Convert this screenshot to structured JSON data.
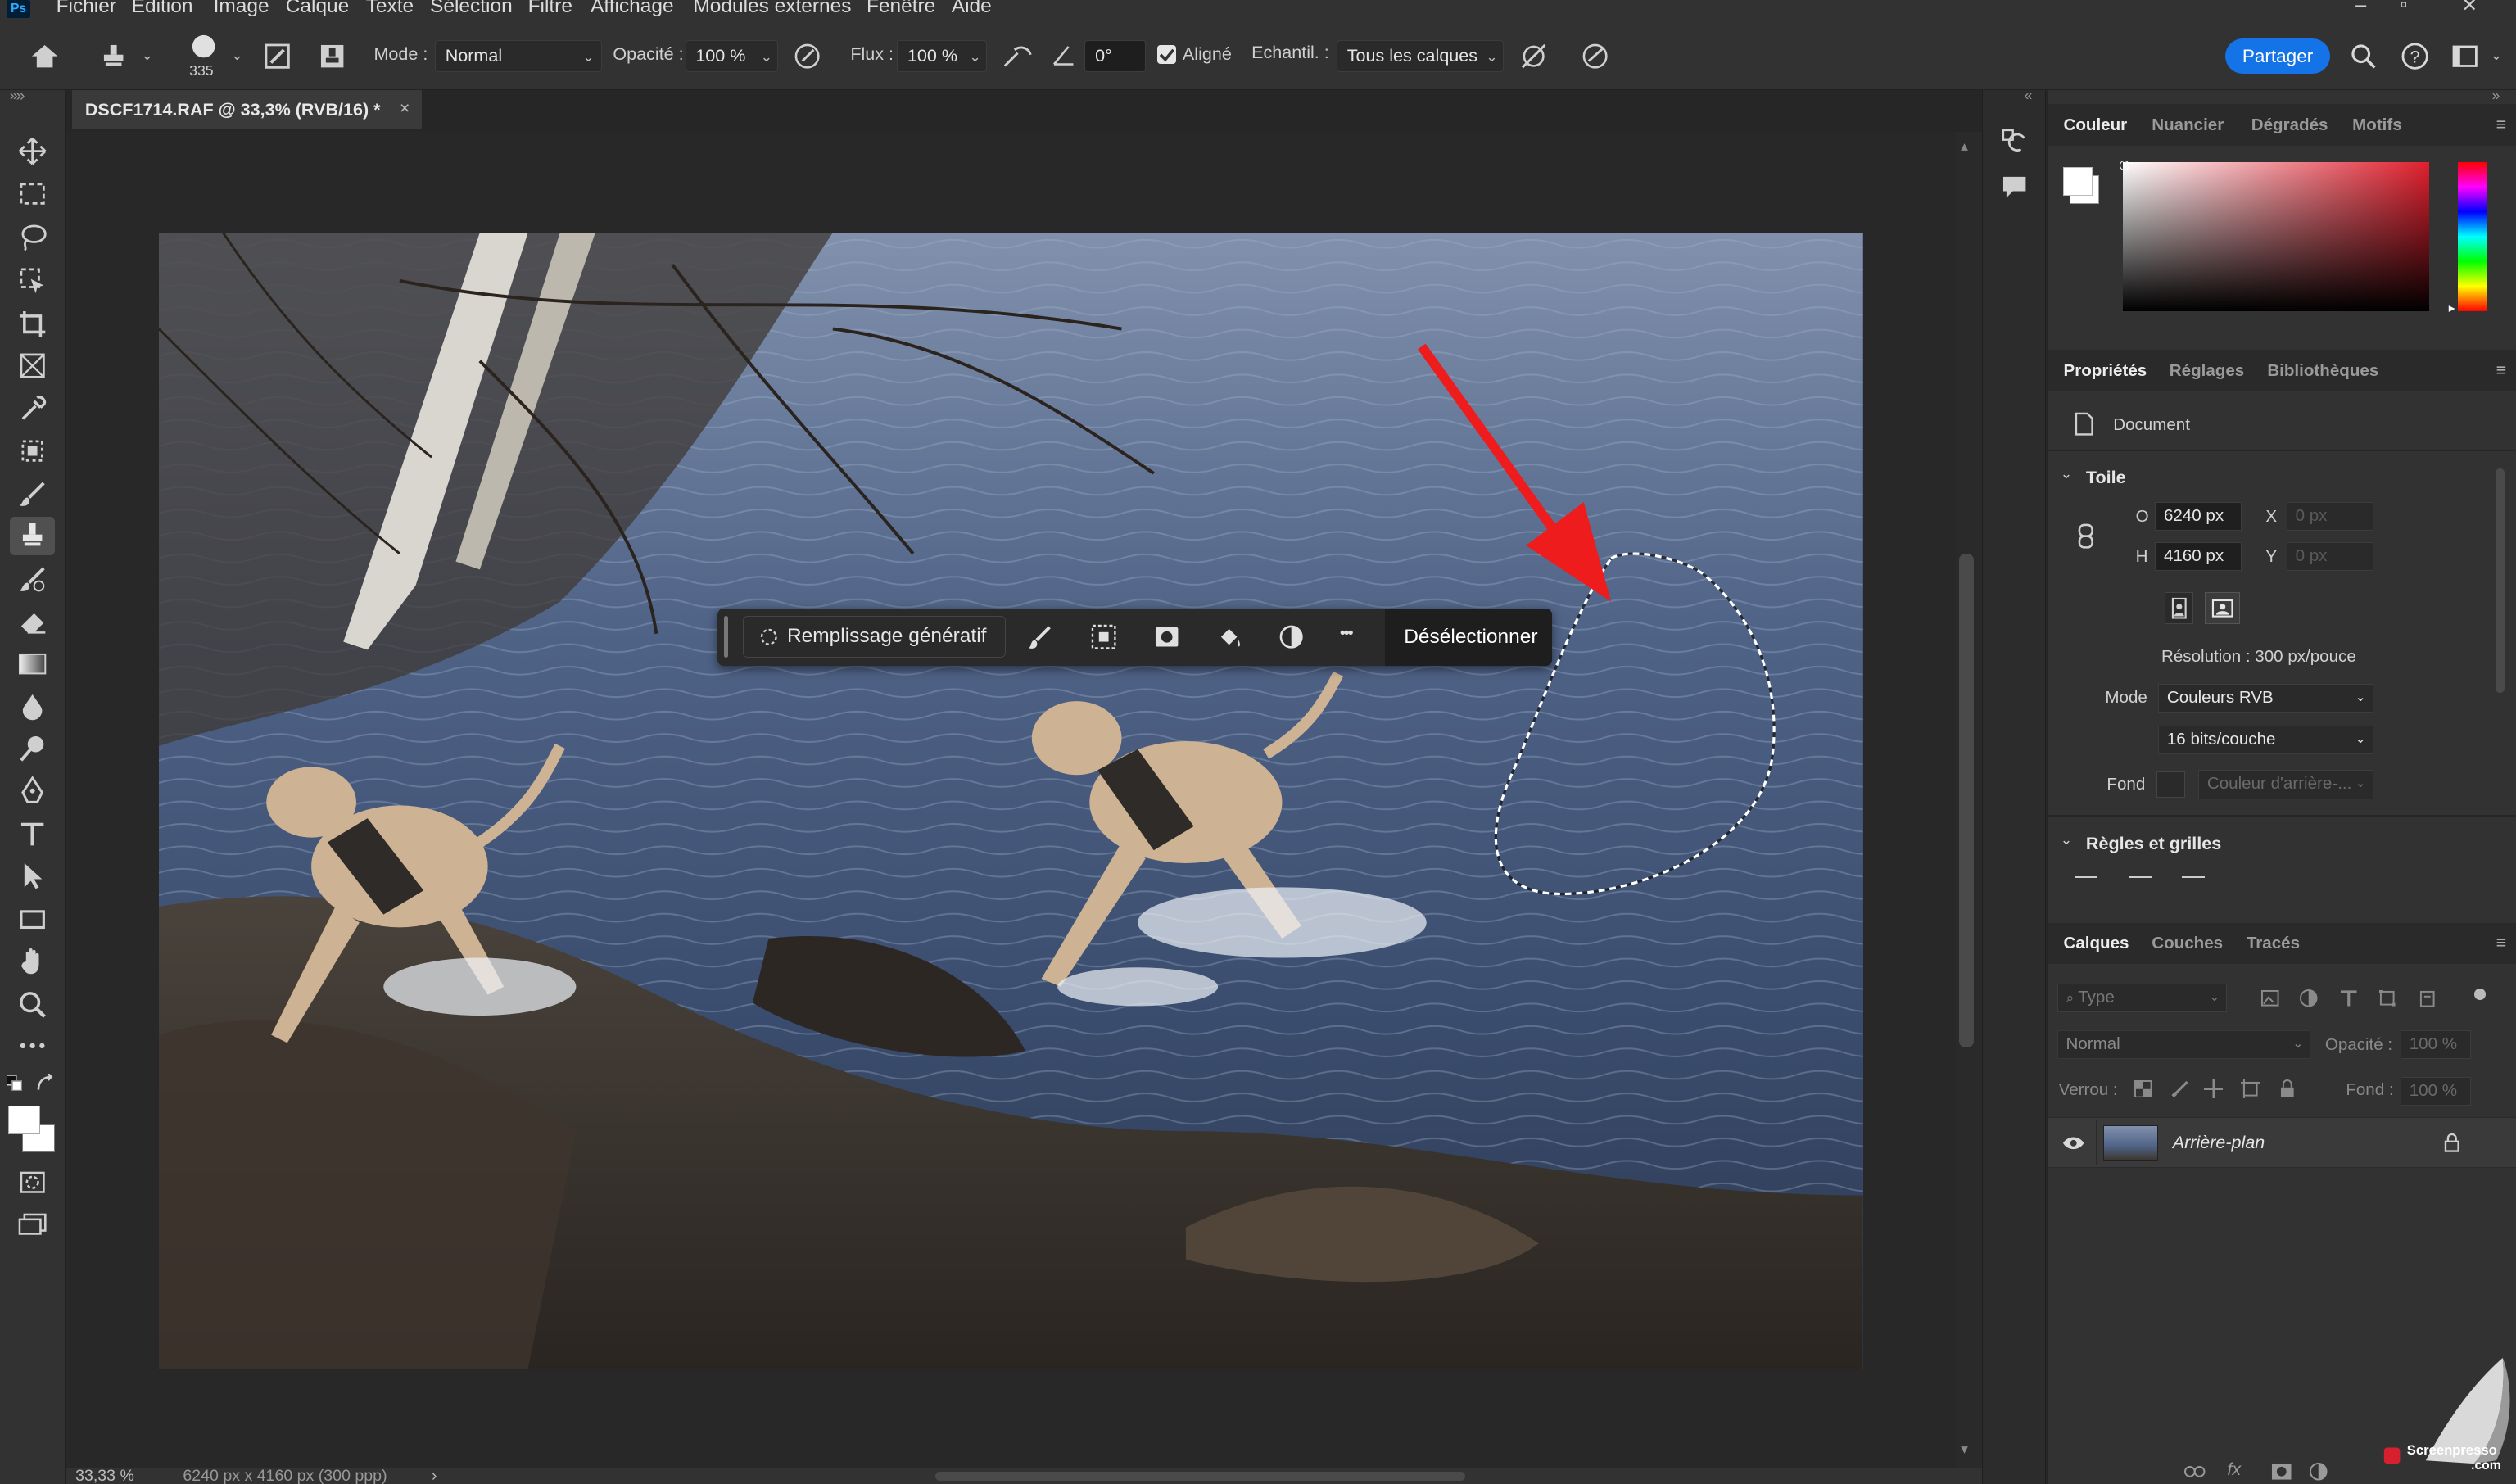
{
  "menubar": {
    "items": [
      "Fichier",
      "Edition",
      "Image",
      "Calque",
      "Texte",
      "Sélection",
      "Filtre",
      "Affichage",
      "Modules externes",
      "Fenêtre",
      "Aide"
    ],
    "window_controls": [
      "–",
      "▫",
      "✕"
    ]
  },
  "options": {
    "brush_size": "335",
    "mode_label": "Mode :",
    "mode_value": "Normal",
    "opacity_label": "Opacité :",
    "opacity_value": "100 %",
    "flow_label": "Flux :",
    "flow_value": "100 %",
    "angle_value": "0°",
    "aligned_label": "Aligné",
    "aligned_checked": true,
    "sample_label": "Echantil. :",
    "sample_value": "Tous les calques",
    "share_label": "Partager"
  },
  "document": {
    "tab_title": "DSCF1714.RAF @ 33,3% (RVB/16) *",
    "close": "×",
    "zoom": "33,33 %",
    "dimensions": "6240 px x 4160 px (300 ppp)",
    "status_arrow": "›"
  },
  "context_bar": {
    "generative_fill": "Remplissage génératif",
    "deselect": "Désélectionner",
    "more": "•••"
  },
  "color_panel": {
    "tabs": [
      "Couleur",
      "Nuancier",
      "Dégradés",
      "Motifs"
    ],
    "foreground": "#ffffff",
    "background": "#ffffff"
  },
  "properties_panel": {
    "tabs": [
      "Propriétés",
      "Réglages",
      "Bibliothèques"
    ],
    "doc_label": "Document",
    "canvas_section": "Toile",
    "width_label": "O",
    "width_value": "6240 px",
    "height_label": "H",
    "height_value": "4160 px",
    "x_label": "X",
    "x_placeholder": "0 px",
    "y_label": "Y",
    "y_placeholder": "0 px",
    "resolution": "Résolution : 300 px/pouce",
    "mode_label": "Mode",
    "mode_value": "Couleurs RVB",
    "depth_value": "16 bits/couche",
    "fill_label": "Fond",
    "fill_value": "Couleur d'arrière-...",
    "rulers_section": "Règles et grilles"
  },
  "layers_panel": {
    "tabs": [
      "Calques",
      "Couches",
      "Tracés"
    ],
    "search_placeholder": "Type",
    "blend_mode": "Normal",
    "opacity_label": "Opacité :",
    "opacity_value": "100 %",
    "lock_label": "Verrou :",
    "fill_label": "Fond :",
    "fill_value": "100 %",
    "layers": [
      {
        "name": "Arrière-plan",
        "visible": true,
        "locked": true
      }
    ]
  },
  "watermark": {
    "text": "Screenpresso",
    "sub": ".com"
  }
}
